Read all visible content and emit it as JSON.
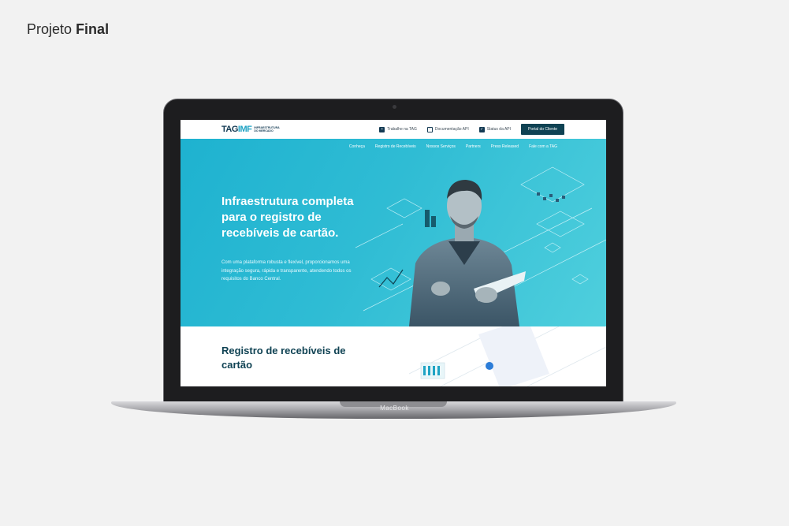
{
  "caption": {
    "prefix": "Projeto",
    "strong": "Final"
  },
  "device": {
    "brand": "MacBook"
  },
  "site": {
    "logo": {
      "mark_a": "TAG",
      "mark_b": "IMF",
      "tagline": "INFRAESTRUTURA DO MERCADO"
    },
    "top_links": [
      {
        "label": "Trabalhe na TAG",
        "icon": "briefcase-icon"
      },
      {
        "label": "Documentação API",
        "icon": "document-icon"
      },
      {
        "label": "Status da API",
        "icon": "check-icon"
      }
    ],
    "portal_button": "Portal do Cliente",
    "nav": [
      "Conheça",
      "Registro de Recebíveis",
      "Nossos Serviços",
      "Partners",
      "Press Released",
      "Fale com a TAG"
    ],
    "hero": {
      "title": "Infraestrutura completa para o registro de recebíveis de cartão.",
      "text": "Com uma plataforma robusta e flexível, proporcionamos uma integração segura, rápida e transparente, atendendo todos os requisitos do Banco Central."
    },
    "section2": {
      "title": "Registro de recebíveis de cartão"
    }
  },
  "colors": {
    "hero_start": "#1eb2d0",
    "hero_end": "#4fcfdd",
    "brand_dark": "#0f4253",
    "brand_accent": "#1fa3c4"
  }
}
